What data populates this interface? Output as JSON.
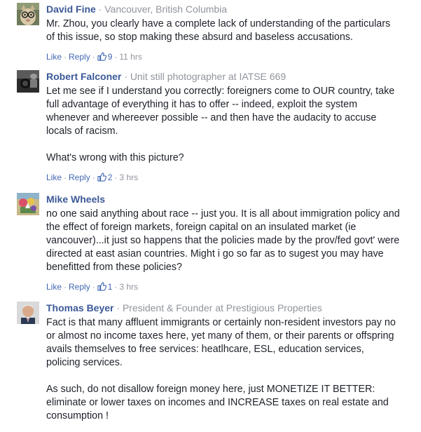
{
  "comments": [
    {
      "author": "David Fine",
      "meta": "Vancouver, British Columbia",
      "avatar": "avatar-cat-glasses",
      "lines": [
        "Mr. Zhou, you clearly have a complete lack of understanding of the particulars",
        "of this issue, so stop making these absurd and baseless accusations."
      ],
      "like_label": "Like",
      "reply_label": "Reply",
      "like_count": "9",
      "time": "11 hrs"
    },
    {
      "author": "Robert Falconer",
      "meta": "Unit still photographer at IATSE 669",
      "avatar": "avatar-bw-camera",
      "lines": [
        "Let me see if I understand you correctly: foreigners come to OUR country, take",
        "full advantage of everything it has to offer -- indeed, exploit the system",
        "whenever and whereever possible -- and then have the audacity to accuse",
        "locals of racism.",
        "",
        "What's wrong with this picture?"
      ],
      "like_label": "Like",
      "reply_label": "Reply",
      "like_count": "2",
      "time": "3 hrs"
    },
    {
      "author": "Mike Wheels",
      "meta": "",
      "avatar": "avatar-colorful",
      "lines": [
        "no one said anything about race -- just you. It is all about immigration policy and",
        "the effect of foreign markets, foreign capital on an insulated market (ie",
        "vancouver)...it just so happens that the policies made by the prov/fed govt' were",
        "directed at east asian countries. Might i go so far as to sugest you may have",
        "benefitted from these policies?"
      ],
      "like_label": "Like",
      "reply_label": "Reply",
      "like_count": "1",
      "time": "3 hrs"
    },
    {
      "author": "Thomas Beyer",
      "meta": "President & Founder at Prestigious Properties",
      "avatar": "avatar-man-portrait",
      "lines": [
        "Fact is that many affluent immigrants or certainly non-resident investors pay no",
        "or almost no income taxes here, yet many of them, or their parents or offspring",
        "avails themselves to free services: heatlhcare, ESL, education services,",
        "policing services.",
        "",
        "As such, do not disallow foreign money here, just MONETIZE IT BETTER:",
        "eliminate or lower taxes on incomes and INCREASE taxes on real estate and",
        "consumption !"
      ]
    }
  ],
  "separator": "·",
  "colors": {
    "author": "#3b5998",
    "link": "#4267b2",
    "meta": "#90949c",
    "text": "#1d2129"
  }
}
